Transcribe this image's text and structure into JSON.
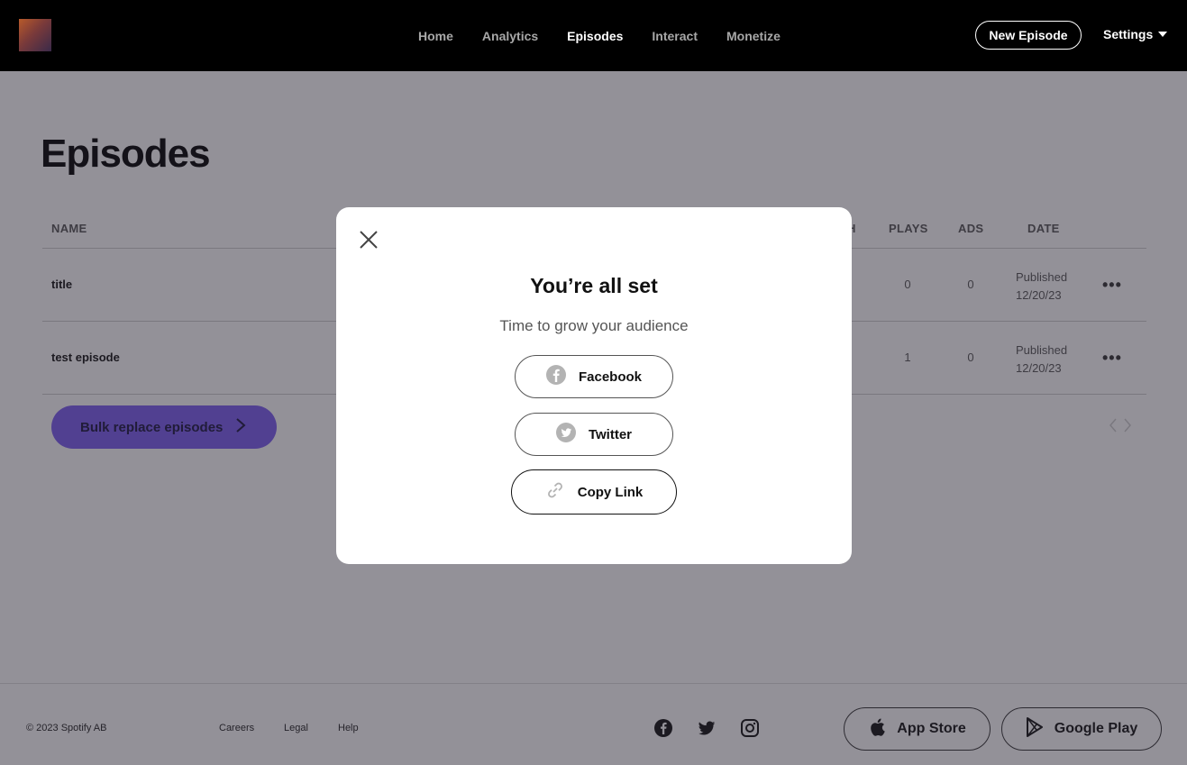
{
  "header": {
    "nav": [
      "Home",
      "Analytics",
      "Episodes",
      "Interact",
      "Monetize"
    ],
    "active_nav": "Episodes",
    "new_episode_label": "New Episode",
    "settings_label": "Settings"
  },
  "main": {
    "title": "Episodes",
    "columns": {
      "name": "NAME",
      "length_fragment": "H",
      "plays": "PLAYS",
      "ads": "ADS",
      "date": "DATE"
    },
    "rows": [
      {
        "name": "title",
        "plays": "0",
        "ads": "0",
        "status": "Published",
        "date": "12/20/23"
      },
      {
        "name": "test episode",
        "plays": "1",
        "ads": "0",
        "status": "Published",
        "date": "12/20/23"
      }
    ],
    "bulk_button_label": "Bulk replace episodes"
  },
  "footer": {
    "copyright": "© 2023 Spotify AB",
    "links": [
      "Careers",
      "Legal",
      "Help"
    ],
    "app_store_label": "App Store",
    "google_play_label": "Google Play"
  },
  "modal": {
    "title": "You’re all set",
    "subtitle": "Time to grow your audience",
    "buttons": {
      "facebook": "Facebook",
      "twitter": "Twitter",
      "copy_link": "Copy Link"
    }
  },
  "colors": {
    "accent_purple": "#7a5cf0",
    "overlay": "rgba(40,36,50,0.5)",
    "header_bg": "#000000"
  }
}
